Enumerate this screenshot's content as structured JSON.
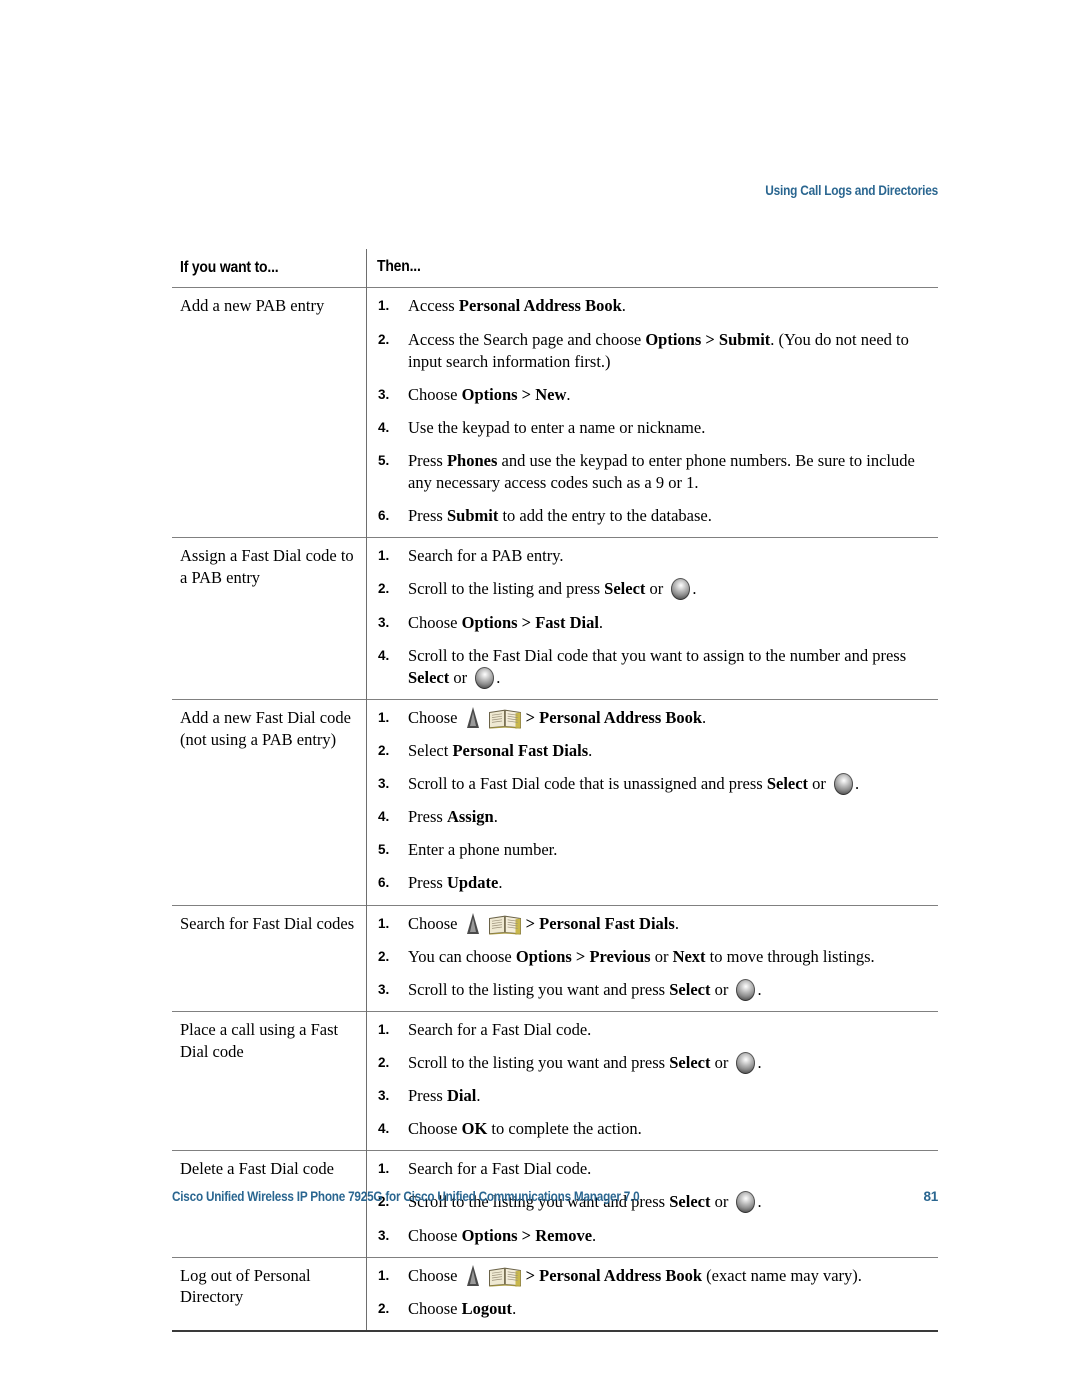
{
  "header": {
    "running_head": "Using Call Logs and Directories"
  },
  "footer": {
    "title": "Cisco Unified Wireless IP Phone 7925G for Cisco Unified Communications Manager 7.0",
    "page_number": "81"
  },
  "colors": {
    "accent_blue": "#2a6690",
    "rule_dark": "#3a3a3a",
    "rule_light": "#808080"
  },
  "table": {
    "columns": [
      "If you want to...",
      "Then..."
    ],
    "rows": [
      {
        "want": "Add a new PAB entry",
        "steps": [
          {
            "num": "1.",
            "parts": [
              {
                "t": "text",
                "v": "Access "
              },
              {
                "t": "bold",
                "v": "Personal Address Book"
              },
              {
                "t": "text",
                "v": "."
              }
            ]
          },
          {
            "num": "2.",
            "parts": [
              {
                "t": "text",
                "v": "Access the Search page and choose "
              },
              {
                "t": "bold",
                "v": "Options > Submit"
              },
              {
                "t": "text",
                "v": ". (You do not need to input search information first.)"
              }
            ]
          },
          {
            "num": "3.",
            "parts": [
              {
                "t": "text",
                "v": "Choose "
              },
              {
                "t": "bold",
                "v": "Options > New"
              },
              {
                "t": "text",
                "v": "."
              }
            ]
          },
          {
            "num": "4.",
            "parts": [
              {
                "t": "text",
                "v": "Use the keypad to enter a name or nickname."
              }
            ]
          },
          {
            "num": "5.",
            "parts": [
              {
                "t": "text",
                "v": "Press "
              },
              {
                "t": "bold",
                "v": "Phones"
              },
              {
                "t": "text",
                "v": " and use the keypad to enter phone numbers. Be sure to include any necessary access codes such as a 9 or 1."
              }
            ]
          },
          {
            "num": "6.",
            "parts": [
              {
                "t": "text",
                "v": "Press "
              },
              {
                "t": "bold",
                "v": "Submit"
              },
              {
                "t": "text",
                "v": " to add the entry to the database."
              }
            ]
          }
        ]
      },
      {
        "want": "Assign a Fast Dial code to a PAB entry",
        "steps": [
          {
            "num": "1.",
            "parts": [
              {
                "t": "text",
                "v": "Search for a PAB entry."
              }
            ]
          },
          {
            "num": "2.",
            "parts": [
              {
                "t": "text",
                "v": "Scroll to the listing and press "
              },
              {
                "t": "bold",
                "v": "Select"
              },
              {
                "t": "text",
                "v": " or "
              },
              {
                "t": "icon",
                "v": "select-button-icon"
              },
              {
                "t": "text",
                "v": "."
              }
            ]
          },
          {
            "num": "3.",
            "parts": [
              {
                "t": "text",
                "v": "Choose "
              },
              {
                "t": "bold",
                "v": "Options > Fast Dial"
              },
              {
                "t": "text",
                "v": "."
              }
            ]
          },
          {
            "num": "4.",
            "parts": [
              {
                "t": "text",
                "v": "Scroll to the Fast Dial code that you want to assign to the number and press "
              },
              {
                "t": "bold",
                "v": "Select"
              },
              {
                "t": "text",
                "v": " or "
              },
              {
                "t": "icon",
                "v": "select-button-icon"
              },
              {
                "t": "text",
                "v": "."
              }
            ]
          }
        ]
      },
      {
        "want": "Add a new Fast Dial code (not using a PAB entry)",
        "steps": [
          {
            "num": "1.",
            "parts": [
              {
                "t": "text",
                "v": "Choose "
              },
              {
                "t": "icon",
                "v": "navigation-key-icon"
              },
              {
                "t": "icon",
                "v": "directories-book-icon"
              },
              {
                "t": "bold",
                "v": "> Personal Address Book"
              },
              {
                "t": "text",
                "v": "."
              }
            ]
          },
          {
            "num": "2.",
            "parts": [
              {
                "t": "text",
                "v": "Select "
              },
              {
                "t": "bold",
                "v": "Personal Fast Dials"
              },
              {
                "t": "text",
                "v": "."
              }
            ]
          },
          {
            "num": "3.",
            "parts": [
              {
                "t": "text",
                "v": "Scroll to a Fast Dial code that is unassigned and press "
              },
              {
                "t": "bold",
                "v": "Select"
              },
              {
                "t": "text",
                "v": " or "
              },
              {
                "t": "icon",
                "v": "select-button-icon"
              },
              {
                "t": "text",
                "v": "."
              }
            ]
          },
          {
            "num": "4.",
            "parts": [
              {
                "t": "text",
                "v": "Press "
              },
              {
                "t": "bold",
                "v": "Assign"
              },
              {
                "t": "text",
                "v": "."
              }
            ]
          },
          {
            "num": "5.",
            "parts": [
              {
                "t": "text",
                "v": "Enter a phone number."
              }
            ]
          },
          {
            "num": "6.",
            "parts": [
              {
                "t": "text",
                "v": "Press "
              },
              {
                "t": "bold",
                "v": "Update"
              },
              {
                "t": "text",
                "v": "."
              }
            ]
          }
        ]
      },
      {
        "want": "Search for Fast Dial codes",
        "steps": [
          {
            "num": "1.",
            "parts": [
              {
                "t": "text",
                "v": "Choose "
              },
              {
                "t": "icon",
                "v": "navigation-key-icon"
              },
              {
                "t": "icon",
                "v": "directories-book-icon"
              },
              {
                "t": "bold",
                "v": "> Personal Fast Dials"
              },
              {
                "t": "text",
                "v": "."
              }
            ]
          },
          {
            "num": "2.",
            "parts": [
              {
                "t": "text",
                "v": "You can choose "
              },
              {
                "t": "bold",
                "v": "Options > Previous"
              },
              {
                "t": "text",
                "v": " or "
              },
              {
                "t": "bold",
                "v": "Next"
              },
              {
                "t": "text",
                "v": " to move through listings."
              }
            ]
          },
          {
            "num": "3.",
            "parts": [
              {
                "t": "text",
                "v": "Scroll to the listing you want and press "
              },
              {
                "t": "bold",
                "v": "Select"
              },
              {
                "t": "text",
                "v": " or "
              },
              {
                "t": "icon",
                "v": "select-button-icon"
              },
              {
                "t": "text",
                "v": "."
              }
            ]
          }
        ]
      },
      {
        "want": "Place a call using a Fast Dial code",
        "steps": [
          {
            "num": "1.",
            "parts": [
              {
                "t": "text",
                "v": "Search for a Fast Dial code."
              }
            ]
          },
          {
            "num": "2.",
            "parts": [
              {
                "t": "text",
                "v": "Scroll to the listing you want and press "
              },
              {
                "t": "bold",
                "v": "Select"
              },
              {
                "t": "text",
                "v": " or "
              },
              {
                "t": "icon",
                "v": "select-button-icon"
              },
              {
                "t": "text",
                "v": "."
              }
            ]
          },
          {
            "num": "3.",
            "parts": [
              {
                "t": "text",
                "v": "Press "
              },
              {
                "t": "bold",
                "v": "Dial"
              },
              {
                "t": "text",
                "v": "."
              }
            ]
          },
          {
            "num": "4.",
            "parts": [
              {
                "t": "text",
                "v": "Choose "
              },
              {
                "t": "bold",
                "v": "OK"
              },
              {
                "t": "text",
                "v": " to complete the action."
              }
            ]
          }
        ]
      },
      {
        "want": "Delete a Fast Dial code",
        "steps": [
          {
            "num": "1.",
            "parts": [
              {
                "t": "text",
                "v": "Search for a Fast Dial code."
              }
            ]
          },
          {
            "num": "2.",
            "parts": [
              {
                "t": "text",
                "v": "Scroll to the listing you want and press "
              },
              {
                "t": "bold",
                "v": "Select"
              },
              {
                "t": "text",
                "v": " or "
              },
              {
                "t": "icon",
                "v": "select-button-icon"
              },
              {
                "t": "text",
                "v": "."
              }
            ]
          },
          {
            "num": "3.",
            "parts": [
              {
                "t": "text",
                "v": "Choose "
              },
              {
                "t": "bold",
                "v": "Options > Remove"
              },
              {
                "t": "text",
                "v": "."
              }
            ]
          }
        ]
      },
      {
        "want": "Log out of Personal Directory",
        "steps": [
          {
            "num": "1.",
            "parts": [
              {
                "t": "text",
                "v": "Choose "
              },
              {
                "t": "icon",
                "v": "navigation-key-icon"
              },
              {
                "t": "icon",
                "v": "directories-book-icon"
              },
              {
                "t": "bold",
                "v": "> Personal Address Book"
              },
              {
                "t": "text",
                "v": " (exact name may vary)."
              }
            ]
          },
          {
            "num": "2.",
            "parts": [
              {
                "t": "text",
                "v": "Choose "
              },
              {
                "t": "bold",
                "v": "Logout"
              },
              {
                "t": "text",
                "v": "."
              }
            ]
          }
        ]
      }
    ]
  }
}
